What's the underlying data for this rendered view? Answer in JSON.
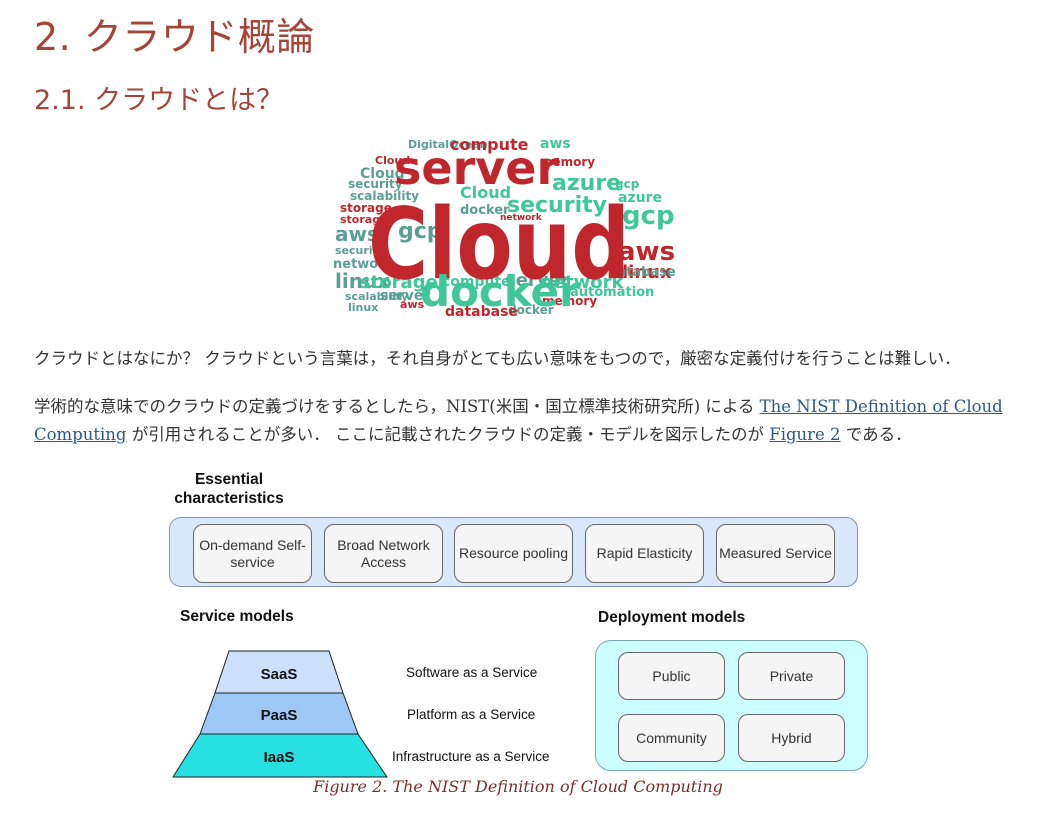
{
  "heading1": "2. クラウド概論",
  "heading2": "2.1. クラウドとは？",
  "word_cloud": {
    "alt": "cloud-word-cloud",
    "words": [
      "Cloud",
      "server",
      "docker",
      "aws",
      "gcp",
      "azure",
      "linux",
      "security",
      "network",
      "storage",
      "compute",
      "memory",
      "database",
      "automation",
      "scalability",
      "DigitalOcean"
    ],
    "colors": {
      "red": "#c0272d",
      "teal": "#3fc79a",
      "grayteal": "#5b9e94"
    }
  },
  "paragraph1": "クラウドとはなにか？ クラウドという言葉は，それ自身がとても広い意味をもつので，厳密な定義付けを行うことは難しい．",
  "paragraph2": {
    "part1": "学術的な意味でのクラウドの定義づけをするとしたら，NIST(米国・国立標準技術研究所) による ",
    "link1": "The NIST Definition of Cloud Computing",
    "part2": " が引用されることが多い．  ここに記載されたクラウドの定義・モデルを図示したのが ",
    "link2": "Figure 2",
    "part3": " である．"
  },
  "figure": {
    "essential": {
      "title": "Essential characteristics",
      "items": [
        "On-demand Self-service",
        "Broad Network Access",
        "Resource pooling",
        "Rapid Elasticity",
        "Measured Service"
      ]
    },
    "service_models": {
      "title": "Service models",
      "layers": [
        {
          "abbr": "SaaS",
          "desc": "Software as a Service",
          "color": "#cce0fb"
        },
        {
          "abbr": "PaaS",
          "desc": "Platform as a Service",
          "color": "#9dc8f5"
        },
        {
          "abbr": "IaaS",
          "desc": "Infrastructure as a Service",
          "color": "#26e0e2"
        }
      ]
    },
    "deployment_models": {
      "title": "Deployment models",
      "items": [
        "Public",
        "Private",
        "Community",
        "Hybrid"
      ]
    },
    "caption": "Figure 2. The NIST Definition of Cloud Computing"
  }
}
